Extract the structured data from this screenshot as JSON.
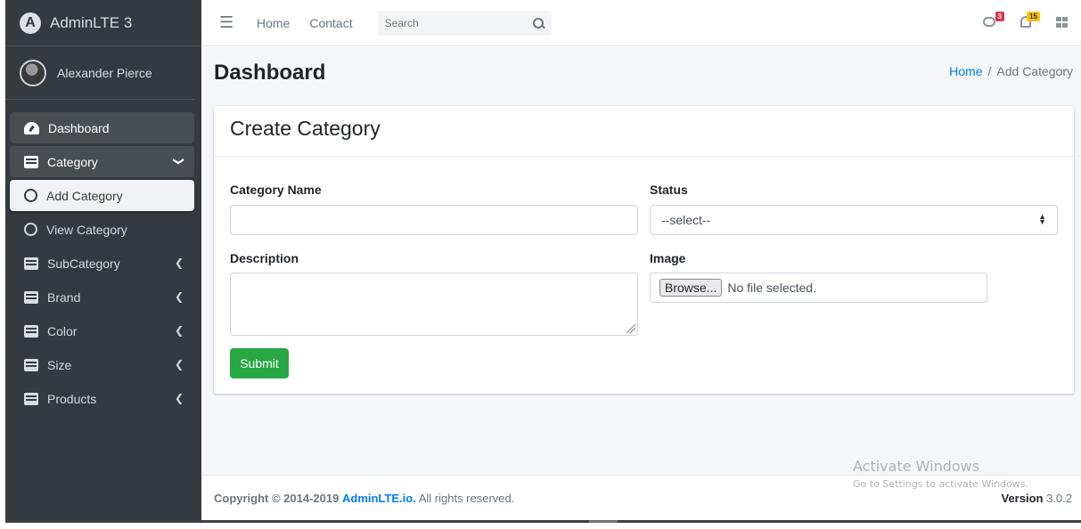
{
  "brand": {
    "name": "AdminLTE 3",
    "logo": "A"
  },
  "user": {
    "name": "Alexander Pierce"
  },
  "sidebar": {
    "items": [
      {
        "label": "Dashboard",
        "icon": "tachometer-icon"
      },
      {
        "label": "Category",
        "icon": "list-icon",
        "expanded": true
      },
      {
        "label": "Add Category",
        "icon": "circle-icon",
        "active": true
      },
      {
        "label": "View Category",
        "icon": "circle-icon"
      },
      {
        "label": "SubCategory",
        "icon": "list-icon"
      },
      {
        "label": "Brand",
        "icon": "list-icon"
      },
      {
        "label": "Color",
        "icon": "list-icon"
      },
      {
        "label": "Size",
        "icon": "list-icon"
      },
      {
        "label": "Products",
        "icon": "list-icon"
      }
    ],
    "arrow_down": "❯",
    "arrow_left": "❮"
  },
  "navbar": {
    "menu_icon": "☰",
    "links": [
      "Home",
      "Contact"
    ],
    "search_placeholder": "Search",
    "messages_count": "3",
    "notifications_count": "15"
  },
  "page": {
    "title": "Dashboard",
    "breadcrumb": {
      "home": "Home",
      "separator": "/",
      "current": "Add Category"
    }
  },
  "form": {
    "card_title": "Create Category",
    "category_name_label": "Category Name",
    "category_name_value": "",
    "status_label": "Status",
    "status_selected": "--select--",
    "description_label": "Description",
    "description_value": "",
    "image_label": "Image",
    "browse_label": "Browse...",
    "file_status": "No file selected.",
    "submit_label": "Submit"
  },
  "footer": {
    "copyright_prefix": "Copyright © 2014-2019",
    "copyright_link": "AdminLTE.io.",
    "copyright_suffix": "All rights reserved.",
    "version_label": "Version",
    "version_number": "3.0.2"
  },
  "watermark": {
    "title": "Activate Windows",
    "subtitle": "Go to Settings to activate Windows."
  },
  "colors": {
    "sidebar_bg": "#343a40",
    "content_bg": "#f4f6f9",
    "primary": "#007bff",
    "success": "#28a745",
    "danger": "#dc3545",
    "warning": "#ffc107"
  }
}
